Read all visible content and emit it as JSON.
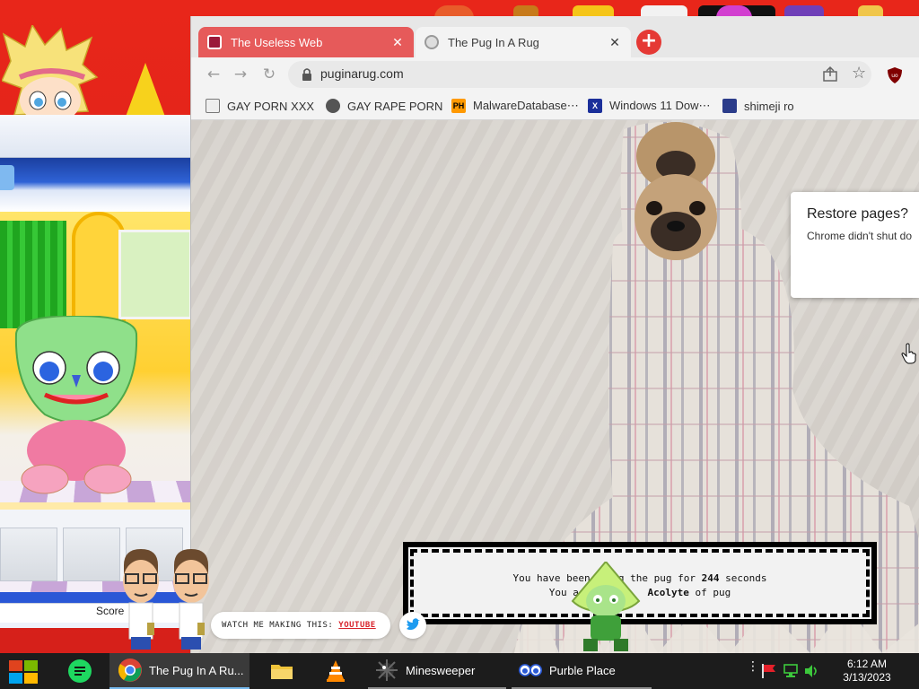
{
  "browser": {
    "tabs": [
      {
        "title": "The Useless Web",
        "active": false
      },
      {
        "title": "The Pug In A Rug",
        "active": true
      }
    ],
    "new_tab_glyph": "+",
    "url": "puginarug.com",
    "bookmarks": [
      {
        "label": "GAY PORN XXX",
        "icon": "bookmark-favicon"
      },
      {
        "label": "GAY RAPE PORN",
        "icon": "globe-icon"
      },
      {
        "label": "MalwareDatabase⋯",
        "icon": "ph-favicon",
        "badge": "PH"
      },
      {
        "label": "Windows 11 Dow⋯",
        "icon": "x-favicon",
        "badge": "X"
      },
      {
        "label": "shimeji ro",
        "icon": "mf-favicon"
      }
    ],
    "restore_popup": {
      "title": "Restore pages?",
      "message": "Chrome didn't shut do"
    }
  },
  "page": {
    "counter_line1_prefix": "You have been h",
    "counter_line1_mid": "g the pug for",
    "counter_seconds": "244",
    "counter_line1_suffix": "seconds",
    "counter_line2_prefix": "You ar",
    "counter_rank": "Acolyte",
    "counter_line2_suffix": "of pug",
    "watch_label": "WATCH ME MAKING THIS:",
    "watch_link": "YOUTUBE"
  },
  "purble_place": {
    "score_label": "Score"
  },
  "taskbar": {
    "items": [
      {
        "label": "",
        "icon": "notes-icon"
      },
      {
        "label": "The Pug In A Ru...",
        "icon": "chrome-icon",
        "state": "active"
      },
      {
        "label": "",
        "icon": "folder-icon"
      },
      {
        "label": "",
        "icon": "vlc-icon"
      },
      {
        "label": "Minesweeper",
        "icon": "mine-icon"
      },
      {
        "label": "Purble Place",
        "icon": "eyes-icon"
      }
    ],
    "time": "6:12 AM",
    "date": "3/13/2023"
  },
  "colors": {
    "desktop_red": "#e02418",
    "tab_useless_web": "#e65a5a",
    "new_tab_button": "#e53935",
    "taskbar": "#1c1c1c",
    "accent": "#76b9ed"
  }
}
